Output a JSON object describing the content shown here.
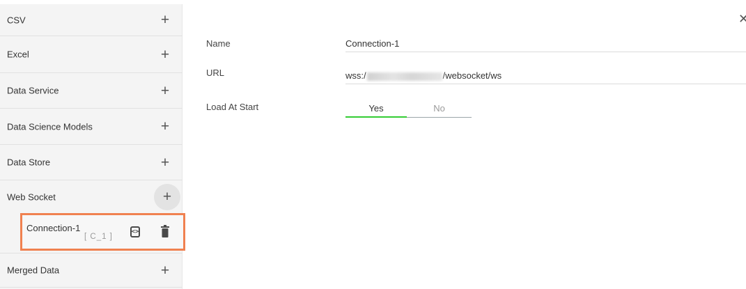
{
  "sidebar": {
    "items": [
      {
        "label": "CSV"
      },
      {
        "label": "Excel"
      },
      {
        "label": "Data Service"
      },
      {
        "label": "Data Science Models"
      },
      {
        "label": "Data Store"
      },
      {
        "label": "Web Socket"
      },
      {
        "label": "Merged Data"
      }
    ],
    "add_icon": "plus-icon",
    "connection": {
      "name": "Connection-1",
      "id": "[ C_1 ]",
      "code_icon": "code-icon",
      "delete_icon": "trash-icon"
    }
  },
  "form": {
    "close_icon": "close-icon",
    "name_label": "Name",
    "name_value": "Connection-1",
    "url_label": "URL",
    "url_prefix": "wss:/",
    "url_suffix": "/websocket/ws",
    "load_label": "Load At Start",
    "yes_label": "Yes",
    "no_label": "No",
    "load_selected": "Yes"
  },
  "colors": {
    "highlight_border": "#f08150",
    "toggle_active": "#33cc33"
  }
}
